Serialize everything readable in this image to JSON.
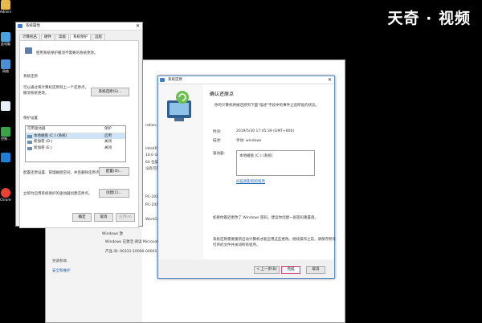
{
  "brand": "天奇 · 视频",
  "desktop_icons": [
    {
      "label": "Adminis...",
      "color": "#e6b94a"
    },
    {
      "label": "此电脑",
      "color": "#4aa3e0"
    },
    {
      "label": "网络",
      "color": "#4a8fd8"
    },
    {
      "label": "",
      "color": "#e8eef5"
    },
    {
      "label": "控制...",
      "color": "#3aa34a"
    },
    {
      "label": "",
      "color": "#1f7ed6"
    },
    {
      "label": "Chrome",
      "color": "#e94235"
    }
  ],
  "back_window": {
    "fragments": [
      "ration, Inc.",
      "Intel(R) Co",
      "16.0 GB",
      "64 位操作",
      "没有可用于",
      "PC-2019",
      "PC-2019",
      "WorkGro",
      "Windows 激",
      "Windows 已激活  阅读 Microsoft 软",
      "产品 ID: 00331-10000-00001-AA57"
    ],
    "section": "另请参阅",
    "sidelink": "安全和维护"
  },
  "system_properties": {
    "title": "系统属性",
    "close": "✕",
    "tabs": [
      "计算机名",
      "硬件",
      "高级",
      "系统保护",
      "远程"
    ],
    "active_tab": 3,
    "intro": "使用系统保护撤消不需要的系统更改。",
    "restore_heading": "系统还原",
    "restore_desc_1": "可以通过将计算机还原到上一个还原点，",
    "restore_desc_2": "撤消系统更改。",
    "restore_button": "系统还原(S)...",
    "settings_heading": "保护设置",
    "col_drive": "可用驱动器",
    "col_protect": "保护",
    "drives": [
      {
        "name": "本地磁盘 (C:) (系统)",
        "status": "启用"
      },
      {
        "name": "新加卷 (D:)",
        "status": "关闭"
      },
      {
        "name": "新加卷 (E:)",
        "status": "关闭"
      }
    ],
    "config_text": "配置还原设置、管理磁盘空间，并且删除还原点。",
    "config_button": "配置(O)...",
    "create_text": "立即为启用系统保护的驱动器创建还原点。",
    "create_button": "创建(C)...",
    "ok": "确定",
    "cancel": "取消",
    "apply": "应用(A)"
  },
  "restore_wizard": {
    "title": "系统还原",
    "close": "✕",
    "heading": "确认还原点",
    "subtitle": "你的计算机将被还原到下面\"描述\"字段中的事件之前所处的状态。",
    "time_label": "时间:",
    "time_value": "2019/5/30 17:45:39 (GMT+800)",
    "desc_label": "描述:",
    "desc_value": "手动: windows",
    "drives_label": "驱动器:",
    "drives_value": "本地磁盘 (C:) (系统)",
    "scan_link": "扫描受影响的程序",
    "password_note": "如果你最近更改了 Windows 密码，建议你创建一张密码重置盘。",
    "restart_note_1": "系统还原需要重新启动计算机才能应用这些更改。继续操作之前，请保存所有",
    "restart_note_2": "打开的文件并关闭所有程序。",
    "back_button": "< 上一步(B)",
    "finish_button": "完成",
    "cancel_button": "取消"
  }
}
